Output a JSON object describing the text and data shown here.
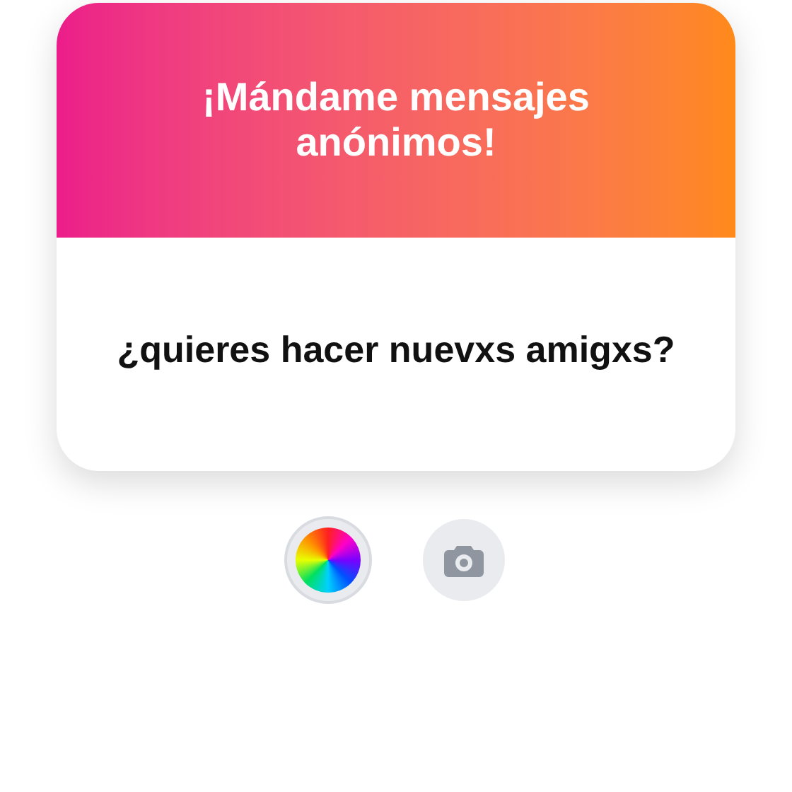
{
  "card": {
    "title": "¡Mándame mensajes anónimos!",
    "question": "¿quieres hacer nuevxs amigxs?"
  },
  "tools": [
    {
      "kind": "color",
      "selected": true
    },
    {
      "kind": "camera",
      "selected": false
    }
  ]
}
